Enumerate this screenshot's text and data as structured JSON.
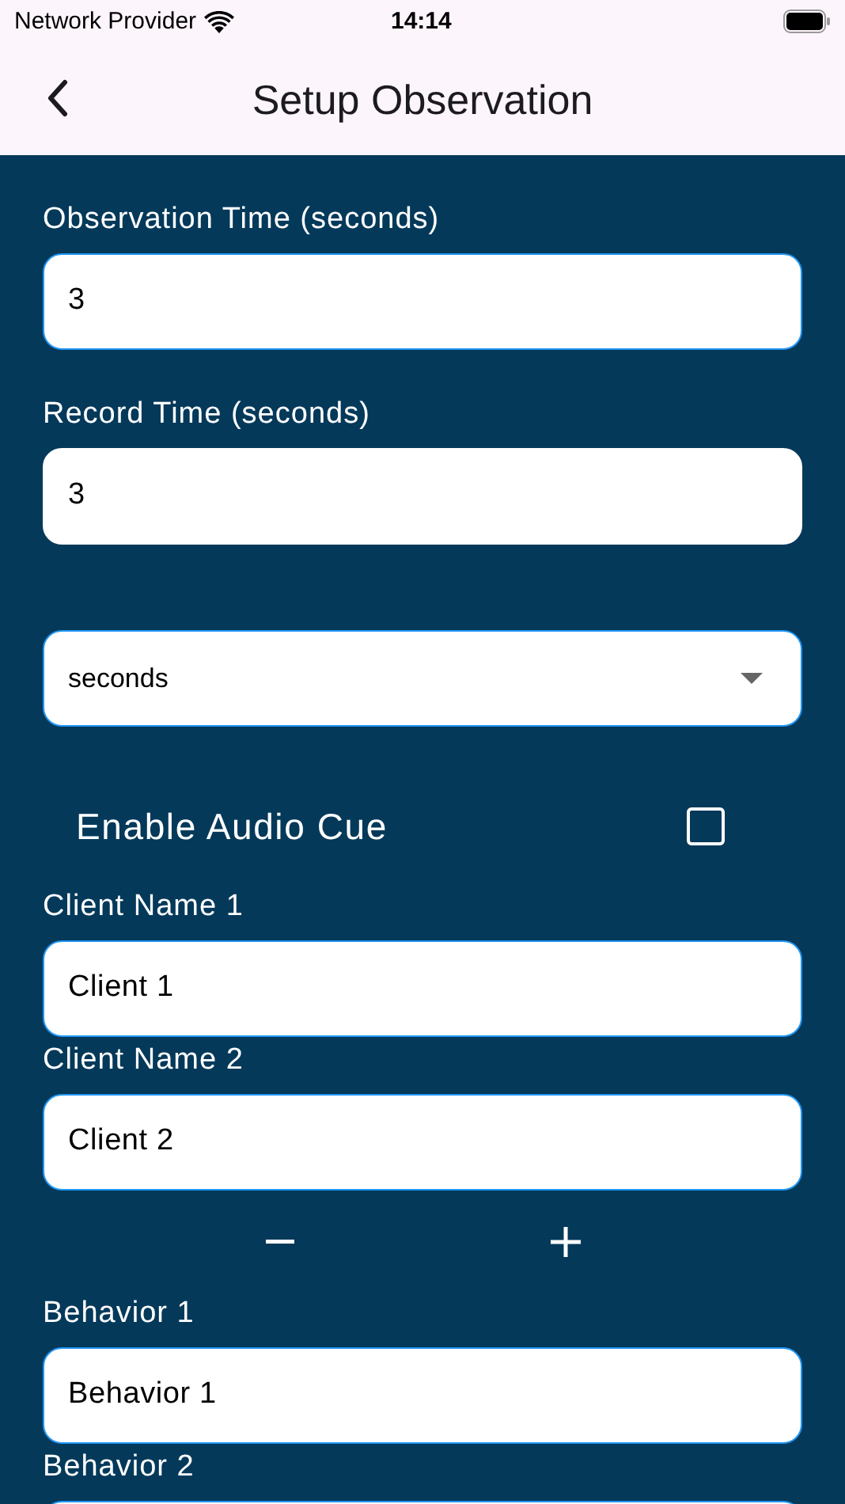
{
  "status_bar": {
    "carrier": "Network Provider",
    "time": "14:14"
  },
  "header": {
    "title": "Setup Observation"
  },
  "form": [
    {
      "kind": "field",
      "label": "Observation Time (seconds)",
      "value": "3",
      "highlighted": true
    },
    {
      "kind": "field",
      "label": "Record Time (seconds)",
      "value": "3",
      "highlighted": false
    },
    {
      "kind": "dropdown",
      "value": "seconds",
      "highlighted": true
    },
    {
      "kind": "checkbox",
      "label": "Enable Audio Cue",
      "checked": false
    },
    {
      "kind": "field",
      "label": "Client Name 1",
      "value": "Client 1",
      "highlighted": true
    },
    {
      "kind": "field",
      "label": "Client Name 2",
      "value": "Client 2",
      "highlighted": true
    },
    {
      "kind": "stepper"
    },
    {
      "kind": "field",
      "label": "Behavior 1",
      "value": "Behavior 1",
      "highlighted": true
    },
    {
      "kind": "field",
      "label": "Behavior 2",
      "highlighted": true
    }
  ]
}
